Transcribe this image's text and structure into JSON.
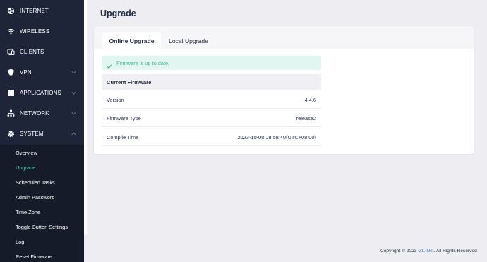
{
  "sidebar": {
    "items": [
      {
        "label": "INTERNET",
        "icon": "globe-icon"
      },
      {
        "label": "WIRELESS",
        "icon": "wifi-icon"
      },
      {
        "label": "CLIENTS",
        "icon": "devices-icon"
      },
      {
        "label": "VPN",
        "icon": "shield-icon",
        "expandable": true
      },
      {
        "label": "APPLICATIONS",
        "icon": "apps-icon",
        "expandable": true
      },
      {
        "label": "NETWORK",
        "icon": "network-icon",
        "expandable": true
      },
      {
        "label": "SYSTEM",
        "icon": "gear-icon",
        "expandable": true,
        "expanded": true
      }
    ],
    "system_submenu": [
      {
        "label": "Overview"
      },
      {
        "label": "Upgrade",
        "active": true
      },
      {
        "label": "Scheduled Tasks"
      },
      {
        "label": "Admin Password"
      },
      {
        "label": "Time Zone"
      },
      {
        "label": "Toggle Button Settings"
      },
      {
        "label": "Log"
      },
      {
        "label": "Reset Firmware"
      }
    ]
  },
  "page": {
    "title": "Upgrade"
  },
  "tabs": [
    {
      "label": "Online Upgrade",
      "active": true
    },
    {
      "label": "Local Upgrade",
      "active": false
    }
  ],
  "alert": {
    "text": "Firmware is up to date.",
    "icon": "check-icon"
  },
  "firmware": {
    "header": "Current Firmware",
    "rows": [
      {
        "key": "Version",
        "value": "4.4.6"
      },
      {
        "key": "Firmware Type",
        "value": "release2"
      },
      {
        "key": "Compile Time",
        "value": "2023-10-08 18:58:40(UTC+08:00)"
      }
    ]
  },
  "footer": {
    "prefix": "Copyright © 2023 ",
    "link": "GL.iNet",
    "suffix": ". All Rights Reserved"
  },
  "colors": {
    "sidebar_bg": "#1e2538",
    "submenu_bg": "#151b29",
    "accent": "#5fd3b9",
    "alert_bg": "#e1f6f1",
    "alert_text": "#3fb89a",
    "link": "#3d7bd9"
  }
}
